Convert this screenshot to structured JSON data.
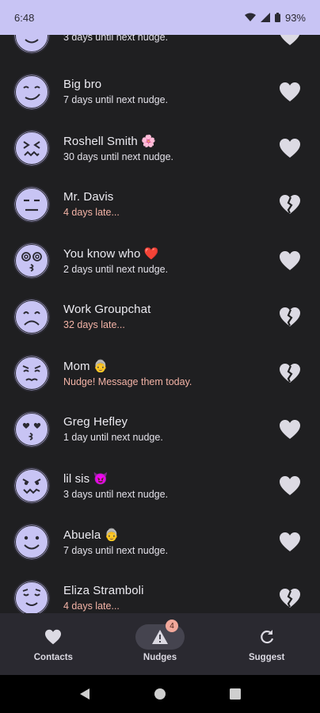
{
  "status_bar": {
    "time": "6:48",
    "battery": "93%"
  },
  "contacts": [
    {
      "name": "",
      "status": "3 days until next nudge.",
      "late": false,
      "face": "happy-face",
      "heart": "full"
    },
    {
      "name": "Big bro",
      "status": "7 days until next nudge.",
      "late": false,
      "face": "smirk-face",
      "heart": "full"
    },
    {
      "name": "Roshell Smith 🌸",
      "status": "30 days until next nudge.",
      "late": false,
      "face": "squint-face",
      "heart": "full"
    },
    {
      "name": "Mr. Davis",
      "status": "4 days late...",
      "late": true,
      "face": "neutral-face",
      "heart": "broken"
    },
    {
      "name": "You know who ❤️",
      "status": "2 days until next nudge.",
      "late": false,
      "face": "dizzy-face",
      "heart": "full"
    },
    {
      "name": "Work Groupchat",
      "status": "32 days late...",
      "late": true,
      "face": "sad-face",
      "heart": "broken"
    },
    {
      "name": "Mom 👵",
      "status": "Nudge! Message them today.",
      "late": true,
      "face": "worried-face",
      "heart": "broken"
    },
    {
      "name": "Greg Hefley",
      "status": "1 day until next nudge.",
      "late": false,
      "face": "heart-eyes-face",
      "heart": "full"
    },
    {
      "name": "lil sis 😈",
      "status": "3 days until next nudge.",
      "late": false,
      "face": "devil-grin-face",
      "heart": "full"
    },
    {
      "name": "Abuela 👵",
      "status": "7 days until next nudge.",
      "late": false,
      "face": "smile-face",
      "heart": "full"
    },
    {
      "name": "Eliza Stramboli",
      "status": "4 days late...",
      "late": true,
      "face": "relieved-face",
      "heart": "broken"
    }
  ],
  "nav": {
    "contacts": "Contacts",
    "nudges": "Nudges",
    "suggest": "Suggest",
    "badge": "4"
  },
  "colors": {
    "accent": "#c8c4f4",
    "late_text": "#f3b3a6",
    "background": "#1f1f21"
  }
}
